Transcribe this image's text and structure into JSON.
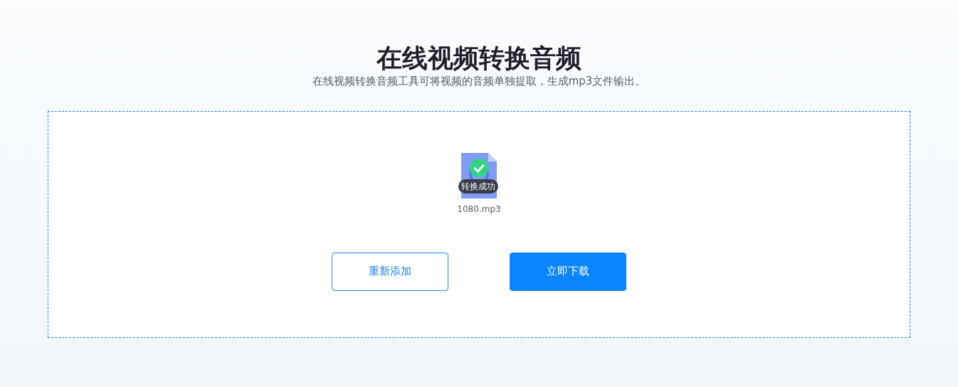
{
  "title": "在线视频转换音频",
  "subtitle": "在线视频转换音频工具可将视频的音频单独提取，生成mp3文件输出。",
  "file": {
    "name": "1080.mp3",
    "status": "转换成功",
    "converted": true
  },
  "buttons": [
    {
      "label": "重新添加",
      "kind": "outline"
    },
    {
      "label": "立即下载",
      "kind": "primary"
    }
  ]
}
